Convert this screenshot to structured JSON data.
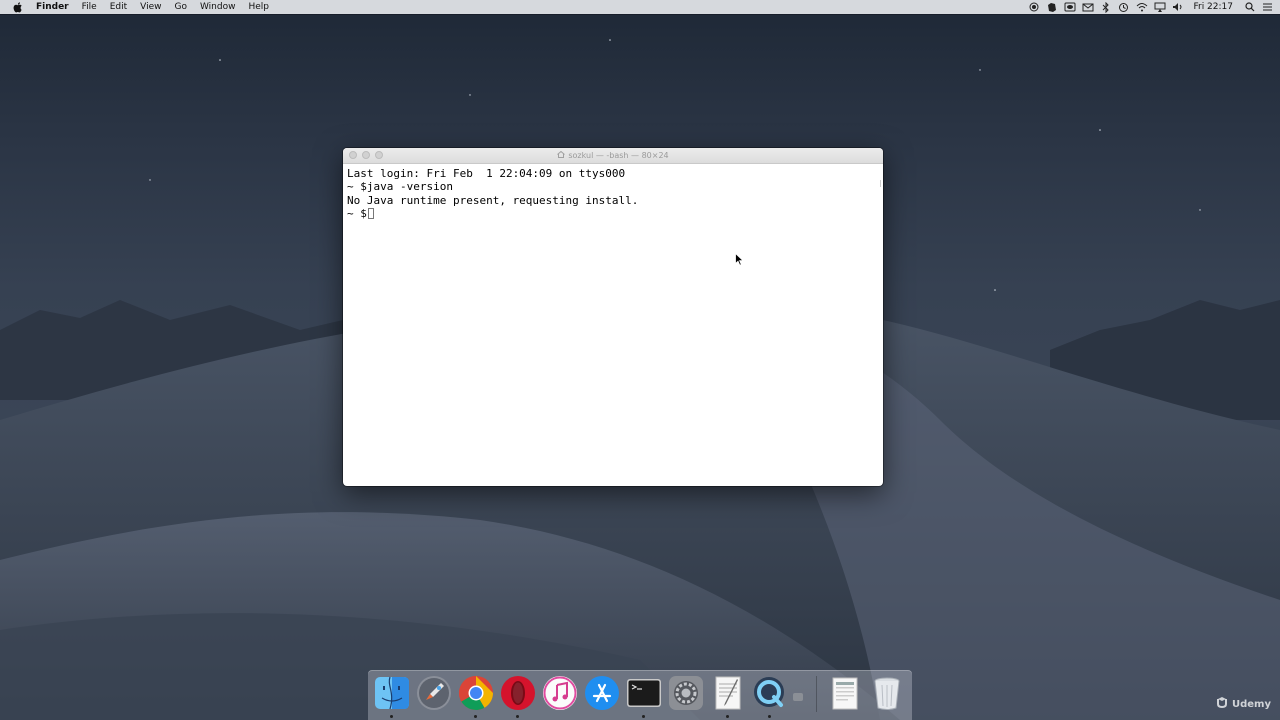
{
  "menubar": {
    "app_name": "Finder",
    "menus": [
      "File",
      "Edit",
      "View",
      "Go",
      "Window",
      "Help"
    ],
    "clock": "Fri 22:17"
  },
  "terminal": {
    "title": "sozkul — -bash — 80×24",
    "lines": [
      "Last login: Fri Feb  1 22:04:09 on ttys000",
      "~ $java -version",
      "No Java runtime present, requesting install."
    ],
    "prompt": "~ $"
  },
  "dock": {
    "items": [
      {
        "name": "finder",
        "running": true
      },
      {
        "name": "launchpad",
        "running": false
      },
      {
        "name": "chrome",
        "running": true
      },
      {
        "name": "opera",
        "running": true
      },
      {
        "name": "itunes",
        "running": false
      },
      {
        "name": "app-store",
        "running": false
      },
      {
        "name": "terminal",
        "running": true
      },
      {
        "name": "system-preferences",
        "running": false
      },
      {
        "name": "textedit",
        "running": true
      },
      {
        "name": "quicktime",
        "running": true
      },
      {
        "name": "documents",
        "running": false
      },
      {
        "name": "trash",
        "running": false
      }
    ]
  },
  "watermark": "Udemy"
}
